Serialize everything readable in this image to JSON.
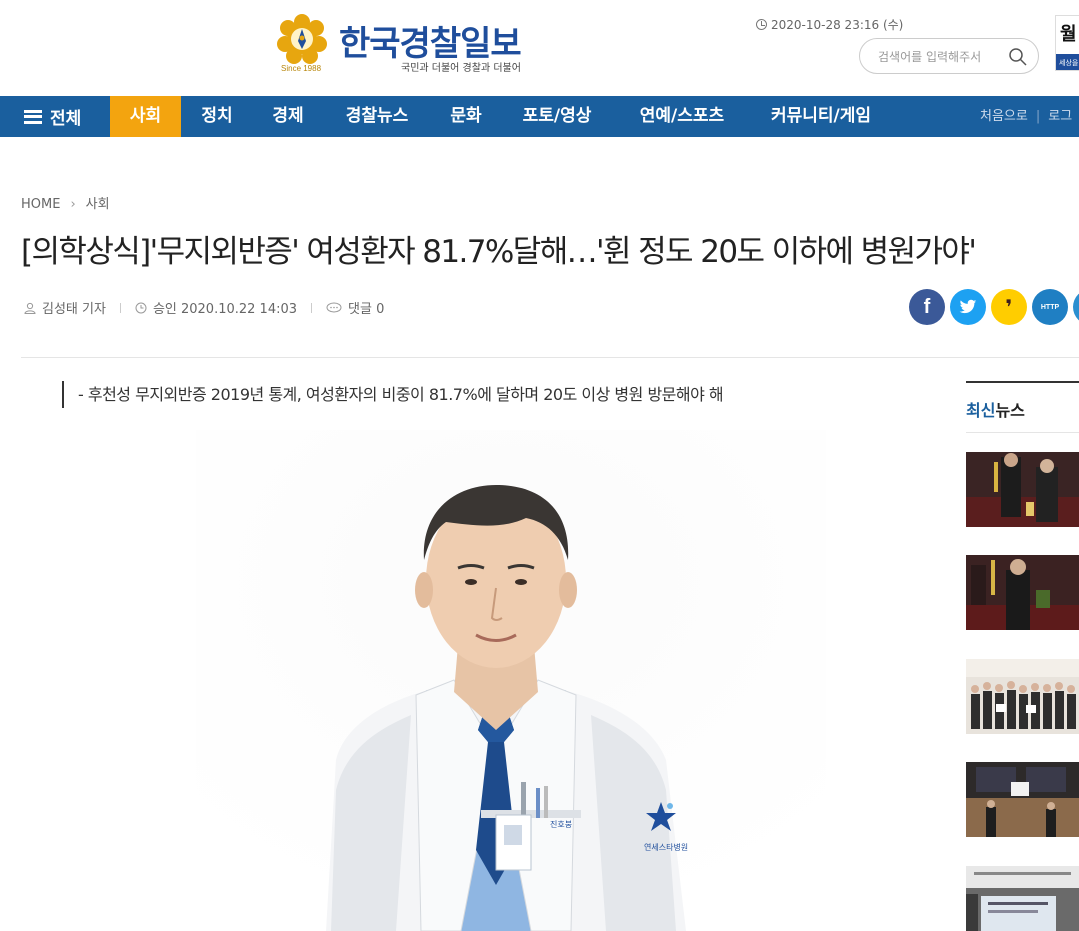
{
  "header": {
    "logo_title": "한국경찰일보",
    "logo_since": "Since 1988",
    "logo_slogan": "국민과 더불어 경찰과 더불어",
    "datetime": "2020-10-28 23:16 (수)",
    "search_placeholder": "검색어를 입력해주서",
    "banner_top": "월",
    "banner_bottom": "세상을"
  },
  "nav": {
    "all_label": "전체",
    "items": [
      "사회",
      "정치",
      "경제",
      "경찰뉴스",
      "문화",
      "포토/영상",
      "연예/스포츠",
      "커뮤니티/게임"
    ],
    "active_index": 0,
    "right_links": [
      "처음으로",
      "로그"
    ],
    "bar_color": "#1a5f9e",
    "active_color": "#f3a40f"
  },
  "article": {
    "breadcrumb": [
      "HOME",
      "사회"
    ],
    "title": "[의학상식]'무지외반증' 여성환자 81.7%달해…'휜 정도 20도 이하에 병원가야'",
    "reporter": "김성태 기자",
    "approved": "승인 2020.10.22 14:03",
    "comments": "댓글 0",
    "summary": "- 후천성 무지외반증 2019년 통계, 여성환자의 비중이 81.7%에 달하며 20도 이상 병원 방문해야 해",
    "photo_badge_name": "진호붕",
    "photo_logo_text": "연세스타병원"
  },
  "share": [
    {
      "name": "facebook",
      "label": "f",
      "color": "#3b5998"
    },
    {
      "name": "twitter",
      "label": "t",
      "color": "#1da1f2"
    },
    {
      "name": "kakaostory",
      "label": "❜",
      "color": "#ffcd00"
    },
    {
      "name": "url-copy",
      "label": "HTTP",
      "color": "#1f7fc3"
    },
    {
      "name": "more",
      "label": "",
      "color": "#2b8fd0"
    }
  ],
  "sidebar": {
    "title_accent": "최신",
    "title_rest": "뉴스"
  }
}
